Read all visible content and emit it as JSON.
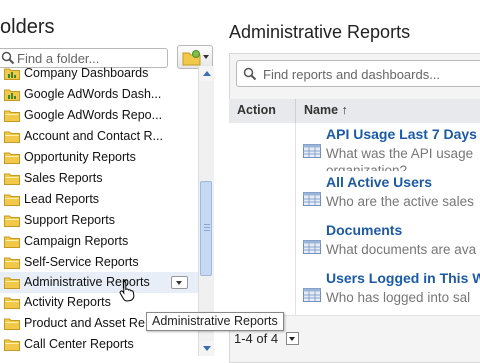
{
  "left_panel": {
    "title": "olders",
    "search_placeholder": "Find a folder...",
    "folders": [
      {
        "label": "Company Dashboards",
        "icon": "dashboard-folder-icon"
      },
      {
        "label": "Google AdWords Dash...",
        "icon": "dashboard-folder-icon"
      },
      {
        "label": "Google AdWords Repo...",
        "icon": "folder-icon"
      },
      {
        "label": "Account and Contact R...",
        "icon": "folder-icon"
      },
      {
        "label": "Opportunity Reports",
        "icon": "folder-icon"
      },
      {
        "label": "Sales Reports",
        "icon": "folder-icon"
      },
      {
        "label": "Lead Reports",
        "icon": "folder-icon"
      },
      {
        "label": "Support Reports",
        "icon": "folder-icon"
      },
      {
        "label": "Campaign Reports",
        "icon": "folder-icon"
      },
      {
        "label": "Self-Service Reports",
        "icon": "folder-icon"
      },
      {
        "label": "Administrative Reports",
        "icon": "folder-icon"
      },
      {
        "label": "Activity Reports",
        "icon": "folder-icon"
      },
      {
        "label": "Product and Asset Re",
        "icon": "folder-icon"
      },
      {
        "label": "Call Center Reports",
        "icon": "folder-icon"
      }
    ]
  },
  "right_panel": {
    "title": "Administrative Reports",
    "search_placeholder": "Find reports and dashboards...",
    "columns": {
      "action": "Action",
      "name": "Name",
      "sort_indicator": "↑"
    },
    "reports": [
      {
        "name": "API Usage Last 7 Days",
        "description": [
          "What was the API usage",
          "organization?"
        ]
      },
      {
        "name": "All Active Users",
        "description": [
          "Who are the active sales"
        ]
      },
      {
        "name": "Documents",
        "description": [
          "What documents are ava"
        ]
      },
      {
        "name": "Users Logged in This W",
        "description": [
          "Who has logged into sal"
        ]
      }
    ],
    "pager": "1-4 of 4"
  },
  "tooltip": "Administrative Reports",
  "colors": {
    "link": "#1c5aa6",
    "folder": "#f2c84b",
    "hover": "#e8eef7"
  }
}
